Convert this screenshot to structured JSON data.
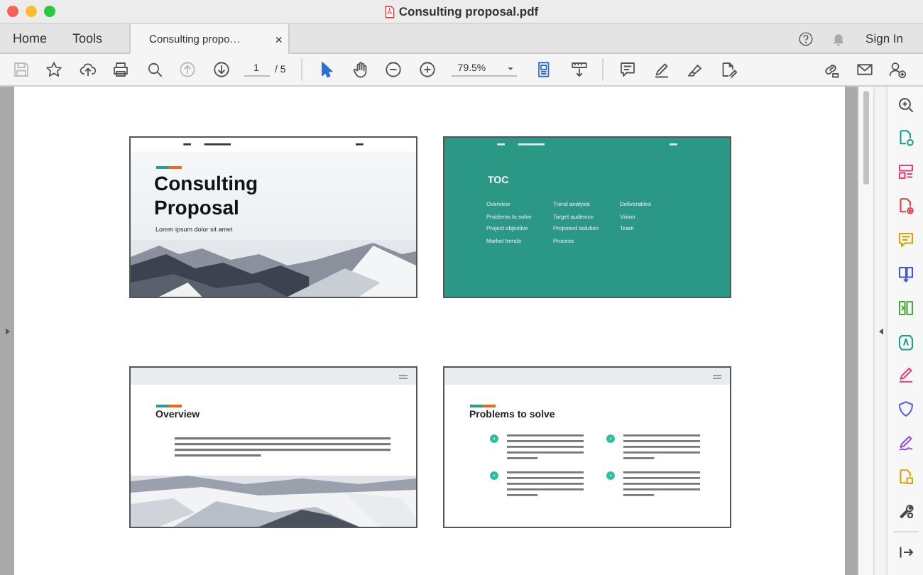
{
  "window": {
    "title": "Consulting proposal.pdf"
  },
  "nav_tabs": [
    {
      "label": "Home"
    },
    {
      "label": "Tools"
    }
  ],
  "document_tab": {
    "label": "Consulting propo…",
    "close": "×"
  },
  "account": {
    "sign_in": "Sign In"
  },
  "toolbar": {
    "page": "1",
    "page_count": "/ 5",
    "zoom": "79.5%",
    "file_tools": [
      {
        "kind": "save",
        "disabled": true
      },
      {
        "kind": "star",
        "disabled": false
      },
      {
        "kind": "upload",
        "disabled": false
      },
      {
        "kind": "print",
        "disabled": false
      },
      {
        "kind": "find",
        "disabled": false
      },
      {
        "kind": "prev",
        "disabled": true
      },
      {
        "kind": "next",
        "disabled": false
      }
    ],
    "view_tools": [
      {
        "kind": "select",
        "selected": true
      },
      {
        "kind": "hand",
        "selected": false
      },
      {
        "kind": "zoom-out",
        "selected": false
      },
      {
        "kind": "zoom-in",
        "selected": false
      }
    ],
    "edit_tools": [
      {
        "kind": "page-view"
      },
      {
        "kind": "scroll"
      },
      {
        "kind": "comment"
      },
      {
        "kind": "highlight"
      },
      {
        "kind": "sign"
      },
      {
        "kind": "fill"
      }
    ],
    "share_tools": [
      {
        "kind": "link"
      },
      {
        "kind": "email"
      },
      {
        "kind": "add-user"
      }
    ]
  },
  "pages": [
    {
      "kind": "cover",
      "title": "Consulting Proposal",
      "subtitle": "Lorem ipsum dolor sit amet"
    },
    {
      "kind": "toc",
      "title": "TOC",
      "columns": [
        [
          "Overview",
          "Problems to solve",
          "Project objective",
          "Market trends"
        ],
        [
          "Trend analysis",
          "Target audience",
          "Proposed solution",
          "Process"
        ],
        [
          "Deliverables",
          "Vision",
          "Team"
        ]
      ]
    },
    {
      "kind": "text",
      "title": "Overview"
    },
    {
      "kind": "points",
      "title": "Problems to solve"
    }
  ],
  "side_tools": [
    {
      "kind": "zoom"
    },
    {
      "kind": "export"
    },
    {
      "kind": "organize"
    },
    {
      "kind": "create"
    },
    {
      "kind": "comment"
    },
    {
      "kind": "combine"
    },
    {
      "kind": "compress"
    },
    {
      "kind": "edit"
    },
    {
      "kind": "fill-sign"
    },
    {
      "kind": "protect"
    },
    {
      "kind": "sign"
    },
    {
      "kind": "scan"
    },
    {
      "kind": "tools"
    },
    {
      "kind": "collapse"
    }
  ]
}
